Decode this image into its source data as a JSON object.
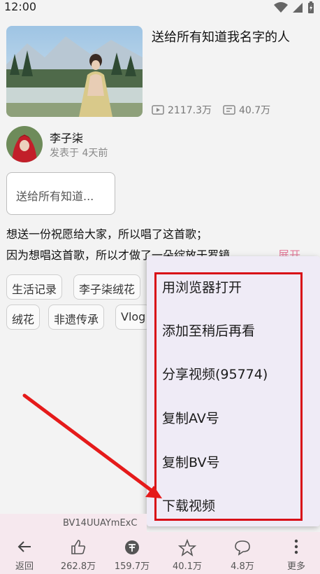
{
  "status": {
    "time": "12:00"
  },
  "video": {
    "title": "送给所有知道我名字的人",
    "views": "2117.3万",
    "danmaku": "40.7万"
  },
  "author": {
    "name": "李子柒",
    "published": "发表于 4天前"
  },
  "collection": {
    "title": "送给所有知道..."
  },
  "description": {
    "line1": "想送一份祝愿给大家，所以唱了这首歌；",
    "line2": "因为想唱这首歌，所以才做了一朵绽放于罗镜",
    "expand": "展开"
  },
  "tags": [
    "生活记录",
    "李子柒绒花",
    "绒花",
    "非遗传承",
    "Vlog"
  ],
  "menu": {
    "items": [
      "用浏览器打开",
      "添加至稍后再看",
      "分享视频(95774)",
      "复制AV号",
      "复制BV号",
      "下载视频"
    ]
  },
  "bv_number": "BV14UUAYmExC",
  "bottom_bar": {
    "back": "返回",
    "like": "262.8万",
    "coin": "159.7万",
    "favorite": "40.1万",
    "comment": "4.8万",
    "more": "更多"
  },
  "colors": {
    "accent_pink": "#e27a9a",
    "highlight_red": "#d80f17",
    "bar_bg": "#f6e8ee"
  }
}
